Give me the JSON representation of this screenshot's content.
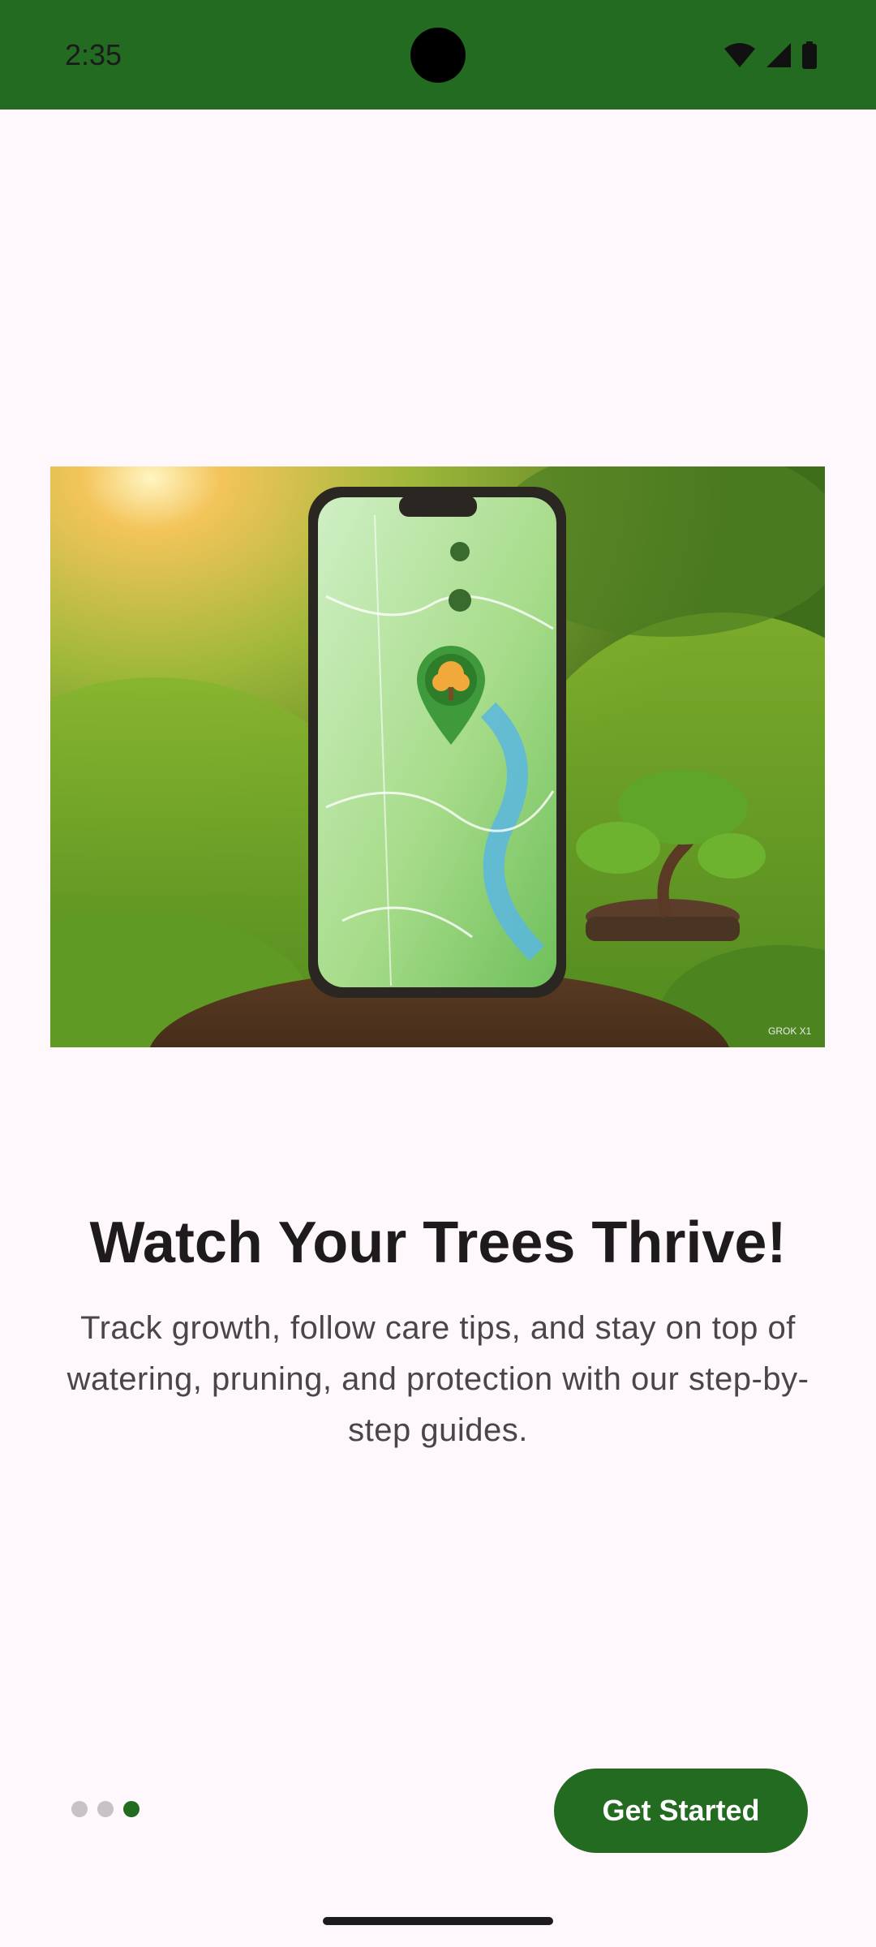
{
  "status_bar": {
    "time": "2:35",
    "background": "#236B21",
    "icons": [
      "wifi-icon",
      "cellular-signal-icon",
      "battery-icon"
    ]
  },
  "hero_image": {
    "description_icon": "map-pin-tree-icon",
    "watermark": "GROK X1"
  },
  "onboarding": {
    "title": "Watch Your Trees Thrive!",
    "subtitle": "Track growth, follow care tips, and stay on top of watering, pruning, and protection with our step-by-step guides.",
    "page_indicator": {
      "total": 3,
      "current": 3
    },
    "cta_label": "Get Started"
  },
  "colors": {
    "primary": "#236B21",
    "background": "#FEF7FB",
    "title_text": "#1E1B1D",
    "body_text": "#4A4549",
    "inactive_dot": "#C7C2C6"
  }
}
